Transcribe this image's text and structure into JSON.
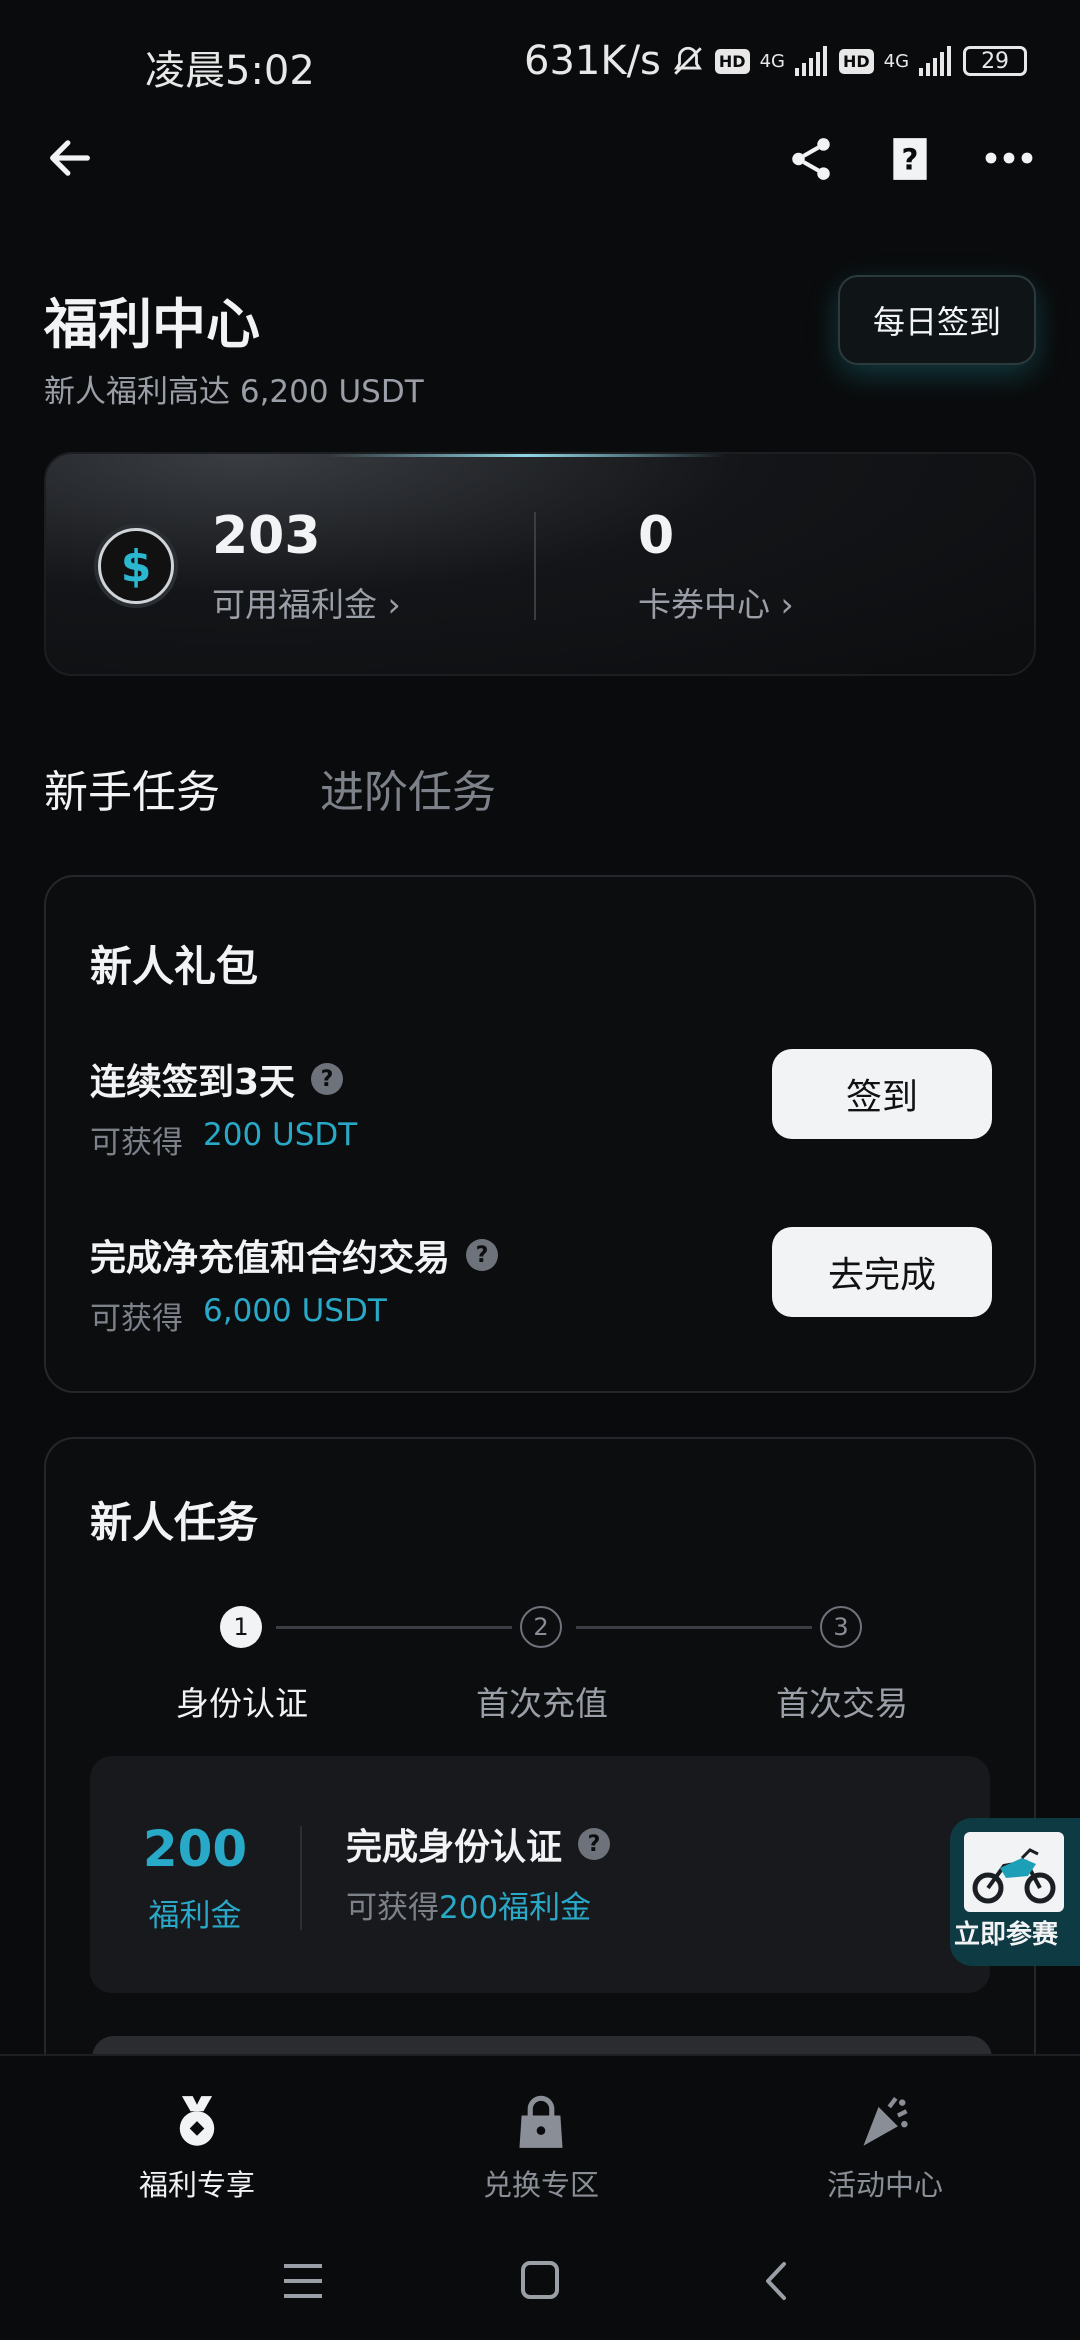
{
  "status_bar": {
    "time": "凌晨5:02",
    "speed": "631K/s",
    "network_1": "4G",
    "network_2": "4G",
    "hd": "HD",
    "battery": "29"
  },
  "nav": {
    "icons": [
      "back-arrow-icon",
      "share-icon",
      "help-icon",
      "more-icon"
    ]
  },
  "header": {
    "title": "福利中心",
    "subtitle": "新人福利高达 6,200 USDT",
    "checkin_label": "每日签到"
  },
  "balance": {
    "welfare_value": "203",
    "welfare_label": "可用福利金 ›",
    "coupon_value": "0",
    "coupon_label": "卡券中心 ›"
  },
  "tabs": [
    {
      "label": "新手任务",
      "active": true
    },
    {
      "label": "进阶任务",
      "active": false
    }
  ],
  "gift_pack": {
    "title": "新人礼包",
    "tasks": [
      {
        "title": "连续签到3天",
        "reward_prefix": "可获得",
        "reward_value": "200 USDT",
        "button": "签到"
      },
      {
        "title": "完成净充值和合约交易",
        "reward_prefix": "可获得",
        "reward_value": "6,000 USDT",
        "button": "去完成"
      }
    ]
  },
  "newbie_tasks": {
    "title": "新人任务",
    "steps": [
      {
        "num": "1",
        "label": "身份认证",
        "active": true
      },
      {
        "num": "2",
        "label": "首次充值",
        "active": false
      },
      {
        "num": "3",
        "label": "首次交易",
        "active": false
      }
    ],
    "current": {
      "amount": "200",
      "amount_unit": "福利金",
      "title": "完成身份认证",
      "reward_prefix": "可获得",
      "reward_value": "200福利金"
    }
  },
  "floating_badge": {
    "label": "立即参赛"
  },
  "bottom_nav": [
    {
      "label": "福利专享",
      "icon": "medal-icon",
      "active": true
    },
    {
      "label": "兑换专区",
      "icon": "lock-bag-icon",
      "active": false
    },
    {
      "label": "活动中心",
      "icon": "party-popper-icon",
      "active": false
    }
  ],
  "colors": {
    "accent": "#29a9c8",
    "background": "#0a0b0c",
    "card_border": "#24272b",
    "muted_text": "#7d8189"
  }
}
